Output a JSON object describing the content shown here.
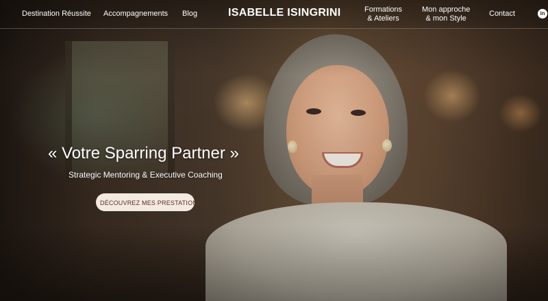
{
  "header": {
    "brand": "ISABELLE ISINGRINI",
    "nav_left": [
      "Destination Réussite",
      "Accompagnements",
      "Blog"
    ],
    "nav_right": [
      {
        "line1": "Formations",
        "line2": "& Ateliers"
      },
      {
        "line1": "Mon approche",
        "line2": "& mon Style"
      },
      {
        "line1": "Contact",
        "line2": ""
      }
    ],
    "social_icon": "linkedin-icon",
    "social_glyph": "in"
  },
  "hero": {
    "title": "« Votre Sparring Partner »",
    "subtitle": "Strategic Mentoring & Executive Coaching",
    "cta_label": "DÉCOUVREZ MES PRESTATIONS"
  },
  "colors": {
    "cta_background": "#f3ebe1",
    "cta_text": "#5a2b26"
  }
}
